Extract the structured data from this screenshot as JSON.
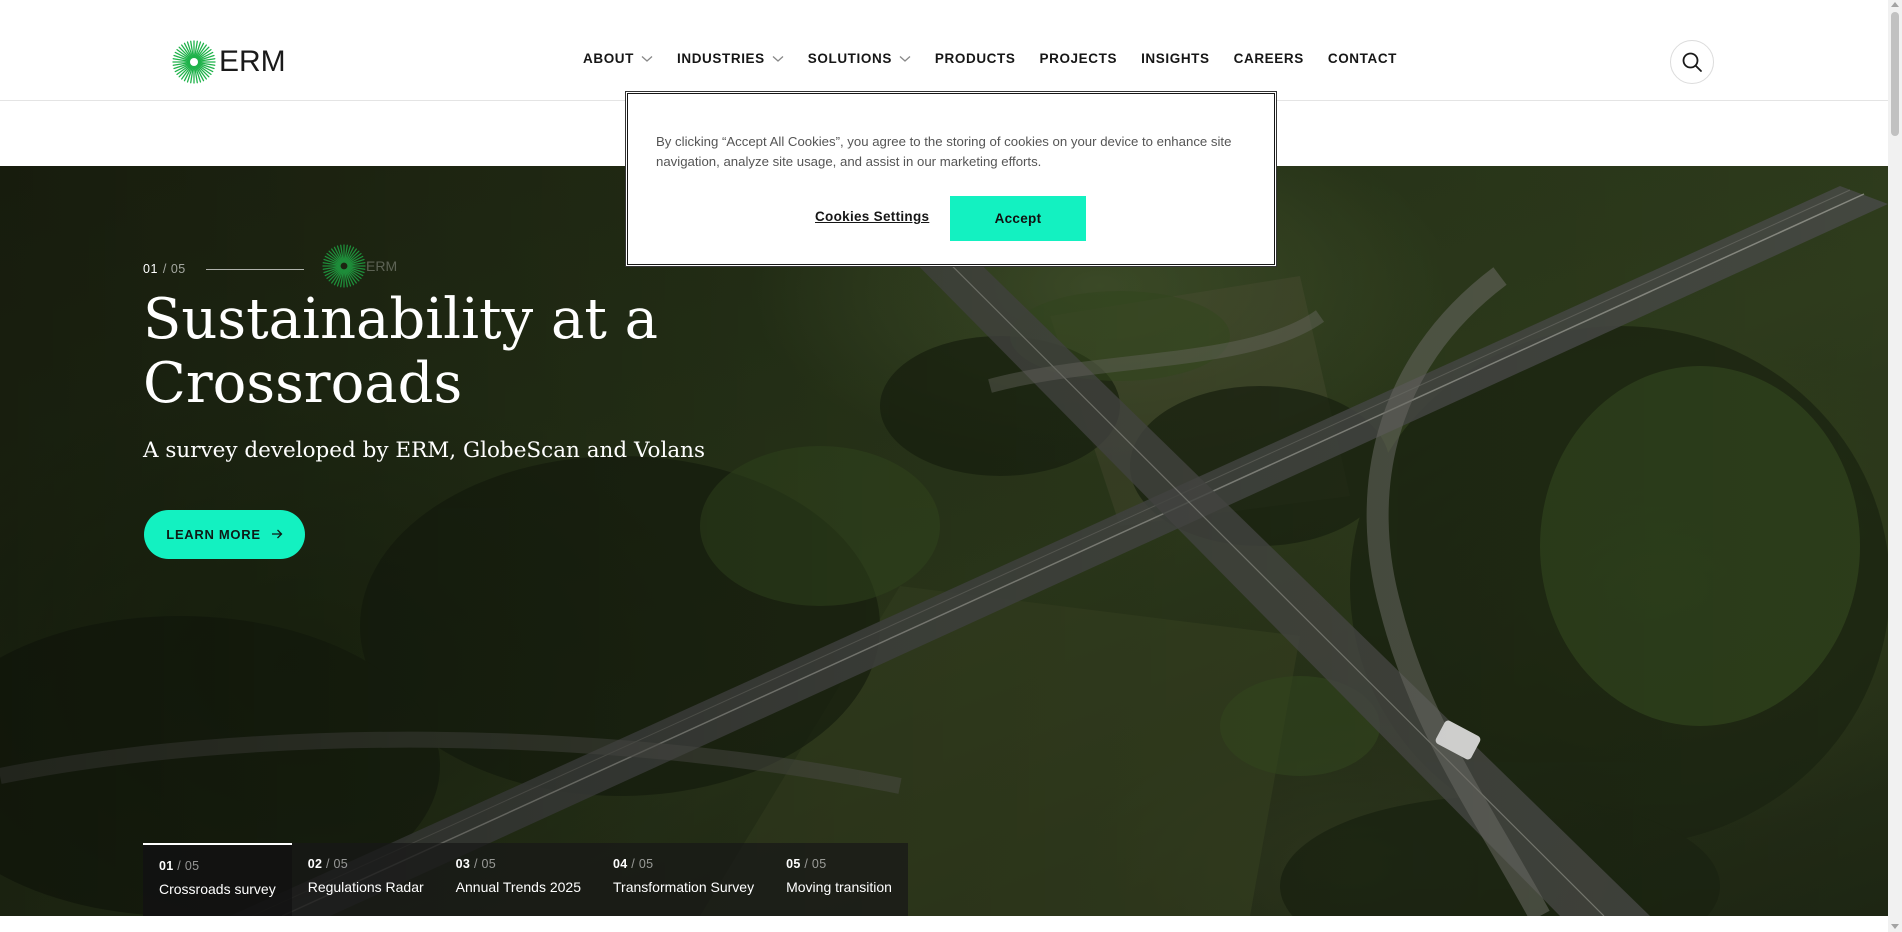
{
  "brand": {
    "name": "ERM",
    "accent": "#13f1c1",
    "logo_green": "#1fb24a"
  },
  "nav": {
    "items": [
      {
        "label": "ABOUT",
        "has_dropdown": true
      },
      {
        "label": "INDUSTRIES",
        "has_dropdown": true
      },
      {
        "label": "SOLUTIONS",
        "has_dropdown": true
      },
      {
        "label": "PRODUCTS",
        "has_dropdown": false
      },
      {
        "label": "PROJECTS",
        "has_dropdown": false
      },
      {
        "label": "INSIGHTS",
        "has_dropdown": false
      },
      {
        "label": "CAREERS",
        "has_dropdown": false
      },
      {
        "label": "CONTACT",
        "has_dropdown": false
      }
    ],
    "search_icon": "search-icon"
  },
  "hero": {
    "counter_current": "01",
    "counter_total": "/ 05",
    "title": "Sustainability at a Crossroads",
    "subtitle": "A survey developed by ERM, GlobeScan and Volans",
    "cta_label": "LEARN MORE",
    "cta_icon": "arrow-right-icon"
  },
  "tabs": [
    {
      "num": "01",
      "of": "/ 05",
      "label": "Crossroads survey",
      "active": true
    },
    {
      "num": "02",
      "of": "/ 05",
      "label": "Regulations Radar",
      "active": false
    },
    {
      "num": "03",
      "of": "/ 05",
      "label": "Annual Trends 2025",
      "active": false
    },
    {
      "num": "04",
      "of": "/ 05",
      "label": "Transformation Survey",
      "active": false
    },
    {
      "num": "05",
      "of": "/ 05",
      "label": "Moving transition",
      "active": false
    }
  ],
  "cookie_banner": {
    "text": "By clicking “Accept All Cookies”, you agree to the storing of cookies on your device to enhance site navigation, analyze site usage, and assist in our marketing efforts.",
    "settings_label": "Cookies Settings",
    "accept_label": "Accept"
  }
}
